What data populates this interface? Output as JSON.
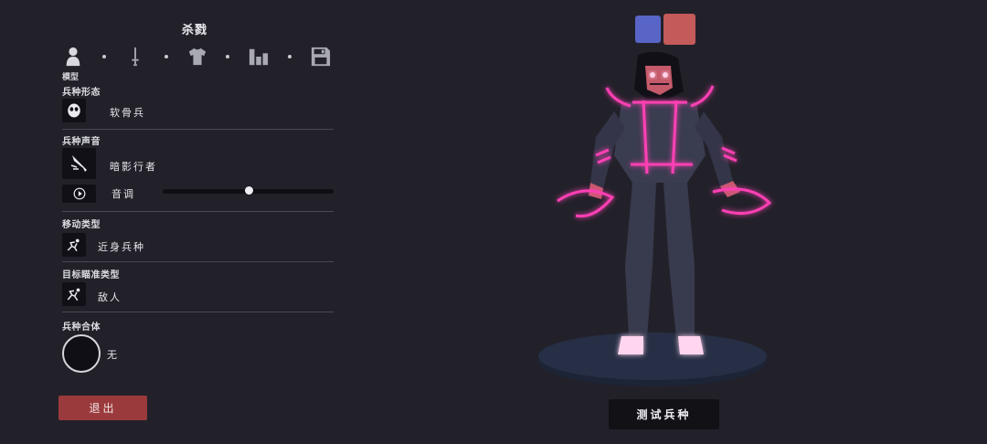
{
  "header": {
    "title": "杀戮"
  },
  "tabs": [
    {
      "name": "model",
      "label": "模型",
      "icon": "person-icon"
    },
    {
      "name": "weapon",
      "label": "",
      "icon": "sword-icon"
    },
    {
      "name": "clothing",
      "label": "",
      "icon": "shirt-icon"
    },
    {
      "name": "stats",
      "label": "",
      "icon": "bars-icon"
    },
    {
      "name": "save",
      "label": "",
      "icon": "save-icon"
    }
  ],
  "sections": {
    "form": {
      "label": "兵种形态",
      "value": "软骨兵",
      "icon": "skull-face-icon"
    },
    "voice": {
      "label": "兵种声音",
      "value": "暗影行者",
      "icon": "dagger-icon",
      "play_icon": "play-icon",
      "pitch_label": "音调",
      "pitch_level": 0.5
    },
    "movement": {
      "label": "移动类型",
      "value": "近身兵种",
      "icon": "melee-run-icon"
    },
    "targeting": {
      "label": "目标瞄准类型",
      "value": "敌人",
      "icon": "target-enemy-icon"
    },
    "merge": {
      "label": "兵种合体",
      "value": "无"
    }
  },
  "buttons": {
    "exit": "退出",
    "test": "测试兵种"
  },
  "team_colors": {
    "blue": "#5865c6",
    "red": "#c45a5a"
  },
  "colors": {
    "accent_exit": "#9b3a3c",
    "neon": "#ff3fb4"
  }
}
